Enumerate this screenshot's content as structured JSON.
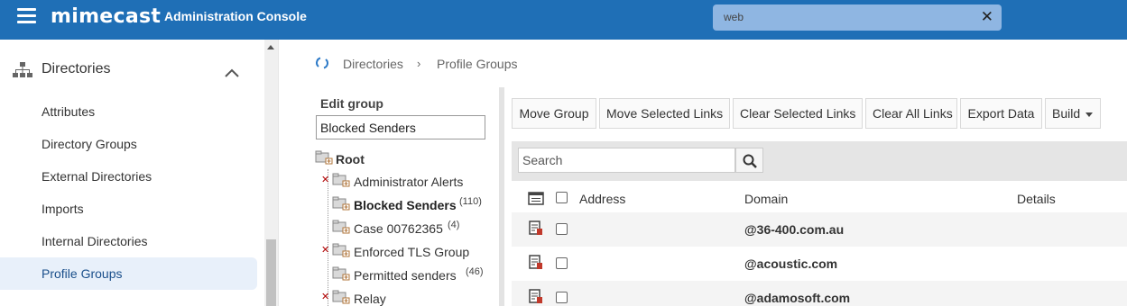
{
  "topbar": {
    "brand": "mimecast",
    "title": "Administration Console",
    "search_value": "web",
    "clear_symbol": "✕",
    "bg_color": "#1f6fb6"
  },
  "sidebar": {
    "section_label": "Directories",
    "section_icon": "hierarchy-icon",
    "items": [
      {
        "label": "Attributes"
      },
      {
        "label": "Directory Groups"
      },
      {
        "label": "External Directories"
      },
      {
        "label": "Imports"
      },
      {
        "label": "Internal Directories"
      },
      {
        "label": "Profile Groups",
        "active": true
      }
    ]
  },
  "breadcrumb": {
    "items": [
      "Directories",
      "Profile Groups"
    ],
    "separator": "›"
  },
  "edit_group": {
    "label": "Edit group",
    "value": "Blocked Senders"
  },
  "tree": {
    "root": "Root",
    "nodes": [
      {
        "label": "Administrator Alerts",
        "count": "",
        "excluded": true
      },
      {
        "label": "Blocked Senders",
        "count": "(110)",
        "selected": true
      },
      {
        "label": "Case 00762365",
        "count": "(4)"
      },
      {
        "label": "Enforced TLS Group",
        "count": "",
        "excluded": true
      },
      {
        "label": "Permitted senders",
        "count": "(46)"
      },
      {
        "label": "Relay",
        "count": "",
        "excluded": true
      }
    ]
  },
  "toolbar": {
    "move_group": "Move Group",
    "move_selected_links": "Move Selected Links",
    "clear_selected_links": "Clear Selected Links",
    "clear_all_links": "Clear All Links",
    "export_data": "Export Data",
    "build": "Build"
  },
  "grid": {
    "search_placeholder": "Search",
    "columns": {
      "address": "Address",
      "domain": "Domain",
      "details": "Details"
    },
    "rows": [
      {
        "address": "",
        "domain": "@36-400.com.au",
        "details": ""
      },
      {
        "address": "",
        "domain": "@acoustic.com",
        "details": ""
      },
      {
        "address": "",
        "domain": "@adamosoft.com",
        "details": ""
      }
    ]
  }
}
